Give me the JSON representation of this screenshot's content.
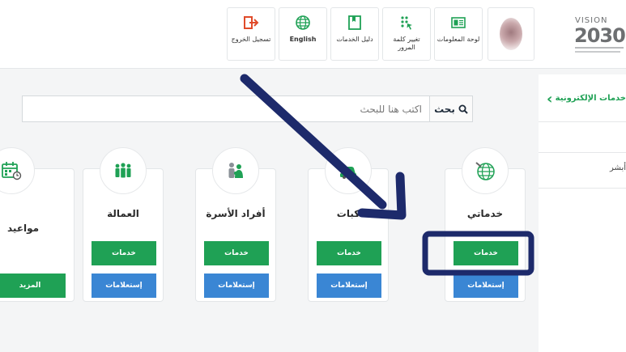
{
  "topbar": {
    "logout": "تسجيل الخروج",
    "english": "English",
    "services_guide": "دليل الخدمات",
    "change_password": "تغيير كلمة المرور",
    "dashboard": "لوحة المعلومات",
    "vision_text": "VISION",
    "vision_year": "2030"
  },
  "search": {
    "button_label": "بحث",
    "placeholder": "اكتب هنا للبحث"
  },
  "cards": [
    {
      "title": "خدماتي",
      "services": "خدمات",
      "inquiries": "إستعلامات",
      "icon": "globe-icon"
    },
    {
      "title": "كبات",
      "services": "خدمات",
      "inquiries": "إستعلامات",
      "icon": "car-icon"
    },
    {
      "title": "أفراد الأسرة",
      "services": "خدمات",
      "inquiries": "إستعلامات",
      "icon": "family-icon"
    },
    {
      "title": "العمالة",
      "services": "خدمات",
      "inquiries": "إستعلامات",
      "icon": "workers-icon"
    },
    {
      "title": "مواعيد",
      "more": "المزيد",
      "icon": "calendar-icon"
    }
  ],
  "sidepanel": {
    "header": "خدمات الإلكترونية",
    "item1": "",
    "item2": "أبشر"
  },
  "colors": {
    "green": "#1fa155",
    "blue": "#3a86d4",
    "annotation_navy": "#1d2a6b"
  }
}
